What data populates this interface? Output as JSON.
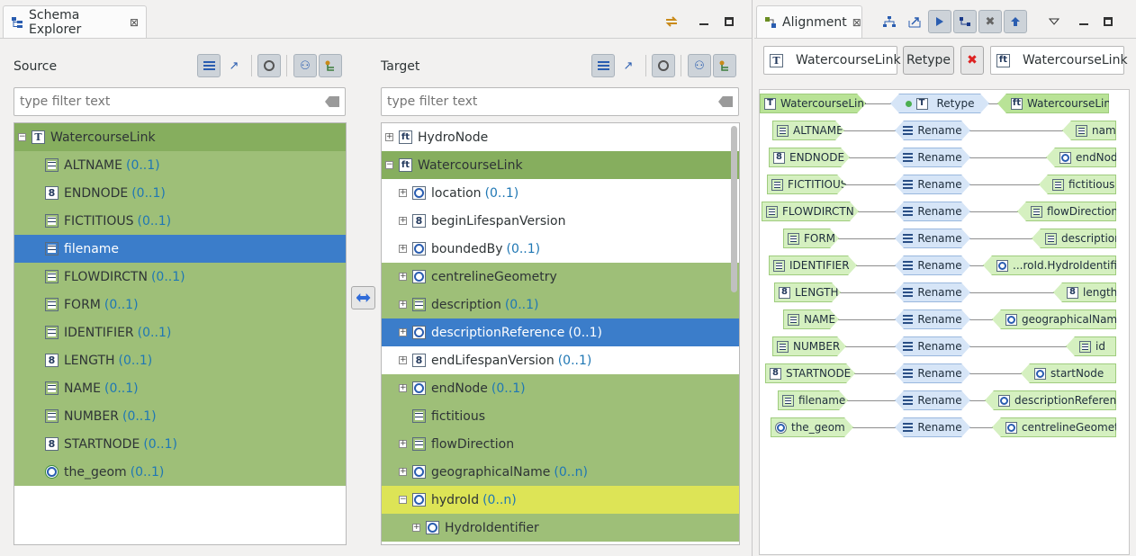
{
  "schema_explorer": {
    "tab_title": "Schema Explorer",
    "tab_close": "⊠",
    "source": {
      "label": "Source",
      "filter_placeholder": "type filter text",
      "rows": [
        {
          "name": "WatercourseLink",
          "card": "",
          "icon": "T",
          "style": "hdr",
          "expander": "−",
          "indent": 0
        },
        {
          "name": "ALTNAME",
          "card": "(0..1)",
          "icon": "lines",
          "style": "green",
          "expander": "",
          "indent": 1
        },
        {
          "name": "ENDNODE",
          "card": "(0..1)",
          "icon": "8",
          "style": "green",
          "expander": "",
          "indent": 1
        },
        {
          "name": "FICTITIOUS",
          "card": "(0..1)",
          "icon": "lines",
          "style": "green",
          "expander": "",
          "indent": 1
        },
        {
          "name": "filename",
          "card": "",
          "icon": "lines",
          "style": "sel",
          "expander": "",
          "indent": 1
        },
        {
          "name": "FLOWDIRCTN",
          "card": "(0..1)",
          "icon": "lines",
          "style": "green",
          "expander": "",
          "indent": 1
        },
        {
          "name": "FORM",
          "card": "(0..1)",
          "icon": "lines",
          "style": "green",
          "expander": "",
          "indent": 1
        },
        {
          "name": "IDENTIFIER",
          "card": "(0..1)",
          "icon": "lines",
          "style": "green",
          "expander": "",
          "indent": 1
        },
        {
          "name": "LENGTH",
          "card": "(0..1)",
          "icon": "8",
          "style": "green",
          "expander": "",
          "indent": 1
        },
        {
          "name": "NAME",
          "card": "(0..1)",
          "icon": "lines",
          "style": "green",
          "expander": "",
          "indent": 1
        },
        {
          "name": "NUMBER",
          "card": "(0..1)",
          "icon": "lines",
          "style": "green",
          "expander": "",
          "indent": 1
        },
        {
          "name": "STARTNODE",
          "card": "(0..1)",
          "icon": "8",
          "style": "green",
          "expander": "",
          "indent": 1
        },
        {
          "name": "the_geom",
          "card": "(0..1)",
          "icon": "geom",
          "style": "green",
          "expander": "",
          "indent": 1
        }
      ]
    },
    "target": {
      "label": "Target",
      "filter_placeholder": "type filter text",
      "rows": [
        {
          "name": "HydroNode",
          "card": "",
          "icon": "ft",
          "style": "white",
          "expander": "+",
          "indent": 0
        },
        {
          "name": "WatercourseLink",
          "card": "",
          "icon": "ft",
          "style": "hdr",
          "expander": "−",
          "indent": 0
        },
        {
          "name": "location",
          "card": "(0..1)",
          "icon": "obj",
          "style": "white",
          "expander": "+",
          "indent": 1
        },
        {
          "name": "beginLifespanVersion",
          "card": "",
          "icon": "8",
          "style": "white",
          "expander": "+",
          "indent": 1
        },
        {
          "name": "boundedBy",
          "card": "(0..1)",
          "icon": "obj",
          "style": "white",
          "expander": "+",
          "indent": 1
        },
        {
          "name": "centrelineGeometry",
          "card": "",
          "icon": "obj",
          "style": "green",
          "expander": "+",
          "indent": 1
        },
        {
          "name": "description",
          "card": "(0..1)",
          "icon": "lines",
          "style": "green",
          "expander": "+",
          "indent": 1
        },
        {
          "name": "descriptionReference",
          "card": "(0..1)",
          "icon": "obj",
          "style": "sel",
          "expander": "+",
          "indent": 1
        },
        {
          "name": "endLifespanVersion",
          "card": "(0..1)",
          "icon": "8",
          "style": "white",
          "expander": "+",
          "indent": 1
        },
        {
          "name": "endNode",
          "card": "(0..1)",
          "icon": "obj",
          "style": "green",
          "expander": "+",
          "indent": 1
        },
        {
          "name": "fictitious",
          "card": "",
          "icon": "lines",
          "style": "green",
          "expander": "",
          "indent": 1
        },
        {
          "name": "flowDirection",
          "card": "",
          "icon": "lines",
          "style": "green",
          "expander": "+",
          "indent": 1
        },
        {
          "name": "geographicalName",
          "card": "(0..n)",
          "icon": "obj",
          "style": "green",
          "expander": "+",
          "indent": 1
        },
        {
          "name": "hydroId",
          "card": "(0..n)",
          "icon": "obj",
          "style": "yellow",
          "expander": "−",
          "indent": 1
        },
        {
          "name": "HydroIdentifier",
          "card": "",
          "icon": "obj",
          "style": "green",
          "expander": "+",
          "indent": 2
        }
      ]
    }
  },
  "alignment": {
    "tab_title": "Alignment",
    "tab_close": "⊠",
    "source_type": "WatercourseLink",
    "retype_button": "Retype",
    "remove_button": "✖",
    "target_type": "WatercourseLink",
    "header_cell": {
      "source": "WatercourseLink",
      "function": "Retype",
      "target": "WatercourseLink"
    },
    "cells": [
      {
        "source": "ALTNAME",
        "src_icon": "lines",
        "function": "Rename",
        "target": "name",
        "tgt_icon": "lines"
      },
      {
        "source": "ENDNODE",
        "src_icon": "8",
        "function": "Rename",
        "target": "endNode",
        "tgt_icon": "obj"
      },
      {
        "source": "FICTITIOUS",
        "src_icon": "lines",
        "function": "Rename",
        "target": "fictitious",
        "tgt_icon": "lines"
      },
      {
        "source": "FLOWDIRCTN",
        "src_icon": "lines",
        "function": "Rename",
        "target": "flowDirection",
        "tgt_icon": "lines"
      },
      {
        "source": "FORM",
        "src_icon": "lines",
        "function": "Rename",
        "target": "description",
        "tgt_icon": "lines"
      },
      {
        "source": "IDENTIFIER",
        "src_icon": "lines",
        "function": "Rename",
        "target": "...roId.HydroIdentifier",
        "tgt_icon": "obj"
      },
      {
        "source": "LENGTH",
        "src_icon": "8",
        "function": "Rename",
        "target": "length",
        "tgt_icon": "8"
      },
      {
        "source": "NAME",
        "src_icon": "lines",
        "function": "Rename",
        "target": "geographicalName",
        "tgt_icon": "obj"
      },
      {
        "source": "NUMBER",
        "src_icon": "lines",
        "function": "Rename",
        "target": "id",
        "tgt_icon": "lines"
      },
      {
        "source": "STARTNODE",
        "src_icon": "8",
        "function": "Rename",
        "target": "startNode",
        "tgt_icon": "obj"
      },
      {
        "source": "filename",
        "src_icon": "lines",
        "function": "Rename",
        "target": "descriptionReference",
        "tgt_icon": "obj"
      },
      {
        "source": "the_geom",
        "src_icon": "geom",
        "function": "Rename",
        "target": "centrelineGeometry",
        "tgt_icon": "obj"
      }
    ]
  },
  "colors": {
    "mapped": "#9ebf78",
    "selected": "#3b7dca",
    "partial": "#dde456",
    "cardinality": "#1f77b4"
  }
}
